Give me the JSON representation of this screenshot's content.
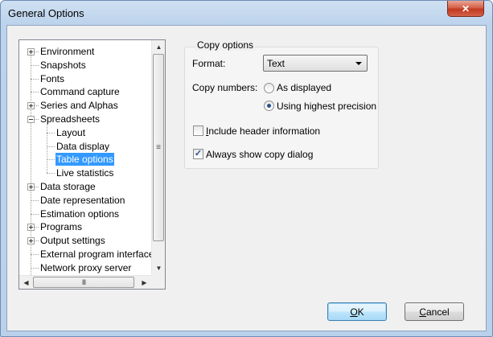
{
  "window": {
    "title": "General Options",
    "close_glyph": "✕"
  },
  "tree": {
    "items": [
      {
        "label": "Environment",
        "expander": "plus"
      },
      {
        "label": "Snapshots"
      },
      {
        "label": "Fonts"
      },
      {
        "label": "Command capture"
      },
      {
        "label": "Series and Alphas",
        "expander": "plus"
      },
      {
        "label": "Spreadsheets",
        "expander": "minus"
      },
      {
        "label": "Layout"
      },
      {
        "label": "Data display"
      },
      {
        "label": "Table options",
        "selected": true
      },
      {
        "label": "Live statistics"
      },
      {
        "label": "Data storage",
        "expander": "plus"
      },
      {
        "label": "Date representation"
      },
      {
        "label": "Estimation options"
      },
      {
        "label": "Programs",
        "expander": "plus"
      },
      {
        "label": "Output settings",
        "expander": "plus"
      },
      {
        "label": "External program interface"
      },
      {
        "label": "Network proxy server"
      }
    ],
    "scroll": {
      "up": "▲",
      "down": "▼",
      "left": "◀",
      "right": "▶",
      "vgrip": "≡",
      "hgrip": "III"
    }
  },
  "copy_options": {
    "title": "Copy options",
    "format_label": "Format:",
    "format_value": "Text",
    "copy_numbers_label": "Copy numbers:",
    "radio_as_displayed": "As displayed",
    "radio_highest_precision": "Using highest precision",
    "selected_radio": "highest_precision",
    "include_header": "Include header information",
    "include_header_checked": false,
    "always_show_dialog": "Always show copy dialog",
    "always_show_dialog_checked": true,
    "check_glyph": "✓"
  },
  "buttons": {
    "ok": "OK",
    "cancel": "Cancel"
  },
  "colors": {
    "selection": "#3399ff",
    "title_bar": "#bcd3ec",
    "close_button": "#c0391f"
  }
}
